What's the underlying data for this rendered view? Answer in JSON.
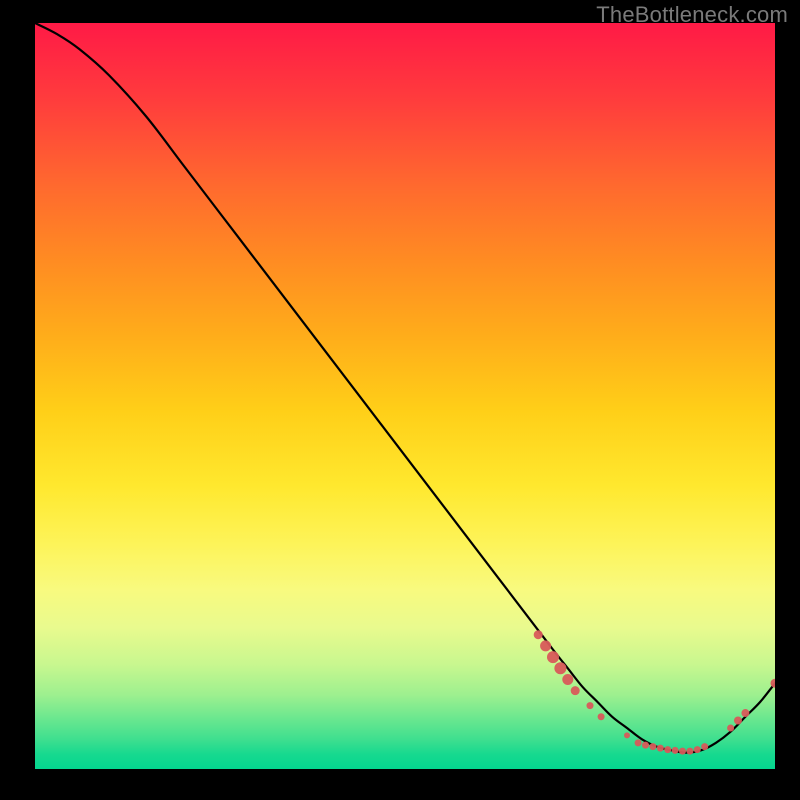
{
  "watermark": "TheBottleneck.com",
  "colors": {
    "background": "#000000",
    "watermark": "#7a7a7a",
    "curve": "#000000",
    "marker": "#d85a5a"
  },
  "chart_data": {
    "type": "line",
    "title": "",
    "xlabel": "",
    "ylabel": "",
    "xlim": [
      0,
      100
    ],
    "ylim": [
      0,
      100
    ],
    "grid": false,
    "legend": false,
    "series": [
      {
        "name": "curve",
        "x": [
          0,
          3,
          6,
          10,
          15,
          20,
          25,
          30,
          35,
          40,
          45,
          50,
          55,
          60,
          65,
          70,
          72,
          74,
          76,
          78,
          80,
          82,
          84,
          86,
          88,
          90,
          92,
          94,
          96,
          98,
          100
        ],
        "y": [
          100,
          98.5,
          96.5,
          93,
          87.5,
          81,
          74.5,
          68,
          61.5,
          55,
          48.5,
          42,
          35.5,
          29,
          22.5,
          16,
          13.5,
          11,
          9,
          7,
          5.5,
          4,
          3,
          2.5,
          2.2,
          2.5,
          3.5,
          5,
          7,
          9,
          11.5
        ]
      }
    ],
    "markers": [
      {
        "x": 68,
        "y": 18,
        "r": 4.5
      },
      {
        "x": 69,
        "y": 16.5,
        "r": 5.5
      },
      {
        "x": 70,
        "y": 15,
        "r": 6.0
      },
      {
        "x": 71,
        "y": 13.5,
        "r": 6.0
      },
      {
        "x": 72,
        "y": 12,
        "r": 5.5
      },
      {
        "x": 73,
        "y": 10.5,
        "r": 4.5
      },
      {
        "x": 75,
        "y": 8.5,
        "r": 3.5
      },
      {
        "x": 76.5,
        "y": 7,
        "r": 3.5
      },
      {
        "x": 80,
        "y": 4.5,
        "r": 3.0
      },
      {
        "x": 81.5,
        "y": 3.5,
        "r": 3.5
      },
      {
        "x": 82.5,
        "y": 3.2,
        "r": 3.5
      },
      {
        "x": 83.5,
        "y": 3.0,
        "r": 3.5
      },
      {
        "x": 84.5,
        "y": 2.8,
        "r": 3.5
      },
      {
        "x": 85.5,
        "y": 2.6,
        "r": 3.5
      },
      {
        "x": 86.5,
        "y": 2.5,
        "r": 3.5
      },
      {
        "x": 87.5,
        "y": 2.4,
        "r": 3.5
      },
      {
        "x": 88.5,
        "y": 2.4,
        "r": 3.5
      },
      {
        "x": 89.5,
        "y": 2.6,
        "r": 3.5
      },
      {
        "x": 90.5,
        "y": 3.0,
        "r": 3.5
      },
      {
        "x": 94,
        "y": 5.5,
        "r": 3.5
      },
      {
        "x": 95,
        "y": 6.5,
        "r": 4.0
      },
      {
        "x": 96,
        "y": 7.5,
        "r": 4.0
      },
      {
        "x": 100,
        "y": 11.5,
        "r": 4.5
      }
    ]
  }
}
